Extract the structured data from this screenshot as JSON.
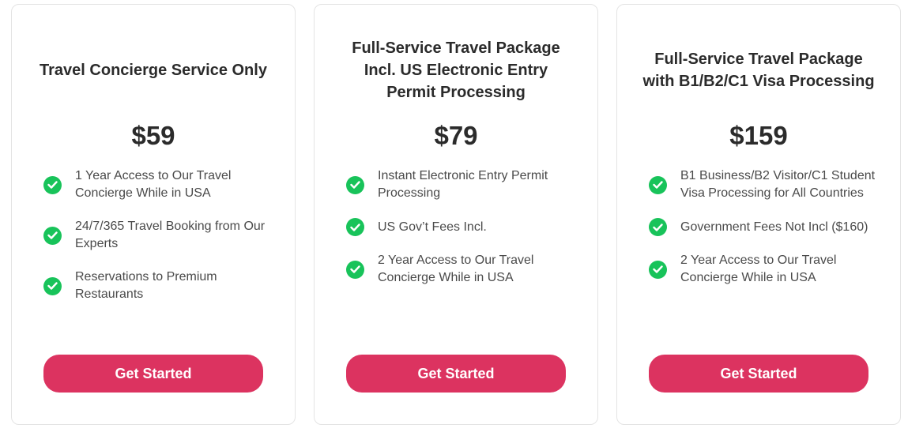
{
  "plans": [
    {
      "title": "Travel Concierge Service Only",
      "price": "$59",
      "features": [
        "1 Year Access to Our Travel Concierge While in USA",
        "24/7/365 Travel Booking from Our Experts",
        "Reservations to Premium Restaurants"
      ],
      "button_label": "Get Started"
    },
    {
      "title": "Full-Service Travel Package Incl. US Electronic Entry Permit Processing",
      "price": "$79",
      "features": [
        "Instant Electronic Entry Permit Processing",
        "US Gov’t Fees Incl.",
        "2 Year Access to Our Travel Concierge While in USA"
      ],
      "button_label": "Get Started"
    },
    {
      "title": "Full-Service Travel Package with B1/B2/C1 Visa Processing",
      "price": "$159",
      "features": [
        "B1 Business/B2 Visitor/C1 Student Visa Processing for All Countries",
        "Government Fees Not Incl ($160)",
        "2 Year Access to Our Travel Concierge While in USA"
      ],
      "button_label": "Get Started"
    }
  ],
  "colors": {
    "accent": "#dc3360",
    "check": "#18c35a",
    "card_border": "#e4e4e4"
  },
  "icons": {
    "feature_bullet": "check-circle-icon"
  }
}
